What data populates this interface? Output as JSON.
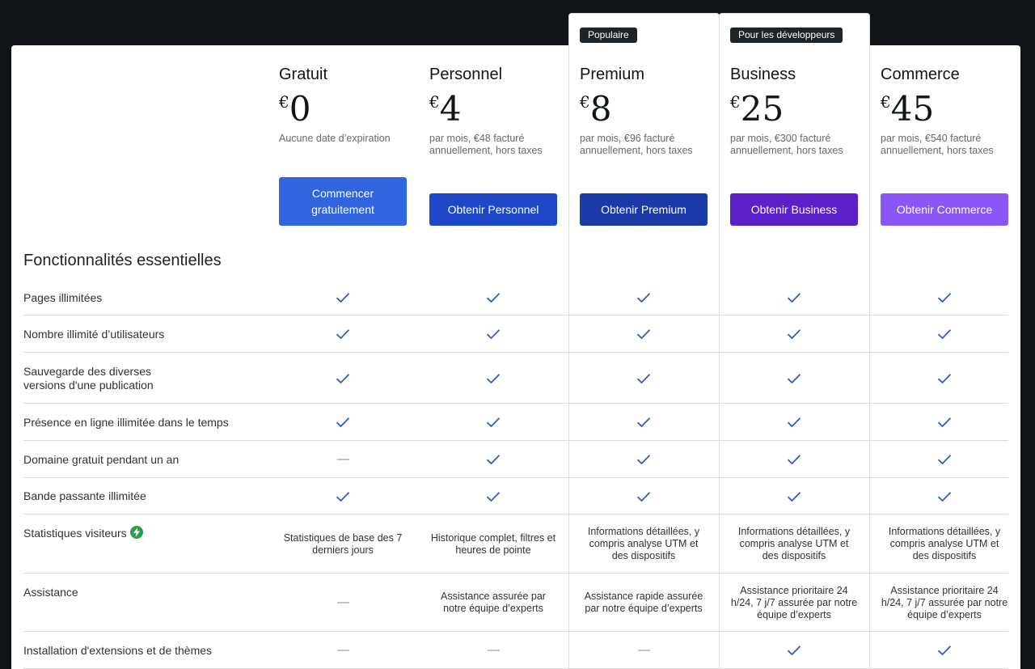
{
  "plans": [
    {
      "key": "gratuit",
      "name": "Gratuit",
      "currency": "€",
      "amount": "0",
      "subtitle": "Aucune date d’expiration",
      "cta": "Commencer gratuitement",
      "color": "#3264e0"
    },
    {
      "key": "personnel",
      "name": "Personnel",
      "currency": "€",
      "amount": "4",
      "subtitle": "par mois, €48 facturé annuellement, hors taxes",
      "cta": "Obtenir Personnel",
      "color": "#1f48c8"
    },
    {
      "key": "premium",
      "name": "Premium",
      "currency": "€",
      "amount": "8",
      "subtitle": "par mois, €96 facturé annuellement, hors taxes",
      "cta": "Obtenir Premium",
      "color": "#1b3aa8",
      "badge": "Populaire"
    },
    {
      "key": "business",
      "name": "Business",
      "currency": "€",
      "amount": "25",
      "subtitle": "par mois, €300 facturé annuellement, hors taxes",
      "cta": "Obtenir Business",
      "color": "#5b21c9",
      "badge": "Pour les développeurs"
    },
    {
      "key": "commerce",
      "name": "Commerce",
      "currency": "€",
      "amount": "45",
      "subtitle": "par mois, €540 facturé annuellement, hors taxes",
      "cta": "Obtenir Commerce",
      "color": "#8a56f5"
    }
  ],
  "section_title": "Fonctionnalités essentielles",
  "features": [
    {
      "label": "Pages illimitées",
      "values": [
        "check",
        "check",
        "check",
        "check",
        "check"
      ]
    },
    {
      "label": "Nombre illimité d’utilisateurs",
      "values": [
        "check",
        "check",
        "check",
        "check",
        "check"
      ]
    },
    {
      "label": "Sauvegarde des diverses versions d'une publication",
      "values": [
        "check",
        "check",
        "check",
        "check",
        "check"
      ]
    },
    {
      "label": "Présence en ligne illimitée dans le temps",
      "values": [
        "check",
        "check",
        "check",
        "check",
        "check"
      ]
    },
    {
      "label": "Domaine gratuit pendant un an",
      "values": [
        "dash",
        "check",
        "check",
        "check",
        "check"
      ]
    },
    {
      "label": "Bande passante illimitée",
      "values": [
        "check",
        "check",
        "check",
        "check",
        "check"
      ]
    },
    {
      "label": "Statistiques visiteurs",
      "icon": "lightning-icon",
      "values": [
        "Statistiques de base des 7 derniers jours",
        "Historique complet, filtres et heures de pointe",
        "Informations détaillées, y compris analyse UTM et des dispositifs",
        "Informations détaillées, y compris analyse UTM et des dispositifs",
        "Informations détaillées, y compris analyse UTM et des dispositifs"
      ]
    },
    {
      "label": "Assistance",
      "values": [
        "dash",
        "Assistance assurée par notre équipe d’experts",
        "Assistance rapide assurée par notre équipe d’experts",
        "Assistance prioritaire 24 h/24, 7 j/7 assurée par notre équipe d’experts",
        "Assistance prioritaire 24 h/24, 7 j/7 assurée par notre équipe d’experts"
      ]
    },
    {
      "label": "Installation d'extensions et de thèmes",
      "values": [
        "dash",
        "dash",
        "dash",
        "check",
        "check"
      ]
    }
  ],
  "colors": {
    "check": "#3858c9",
    "dash": "#c3c4c7",
    "lightning": "#2c9d4b"
  }
}
